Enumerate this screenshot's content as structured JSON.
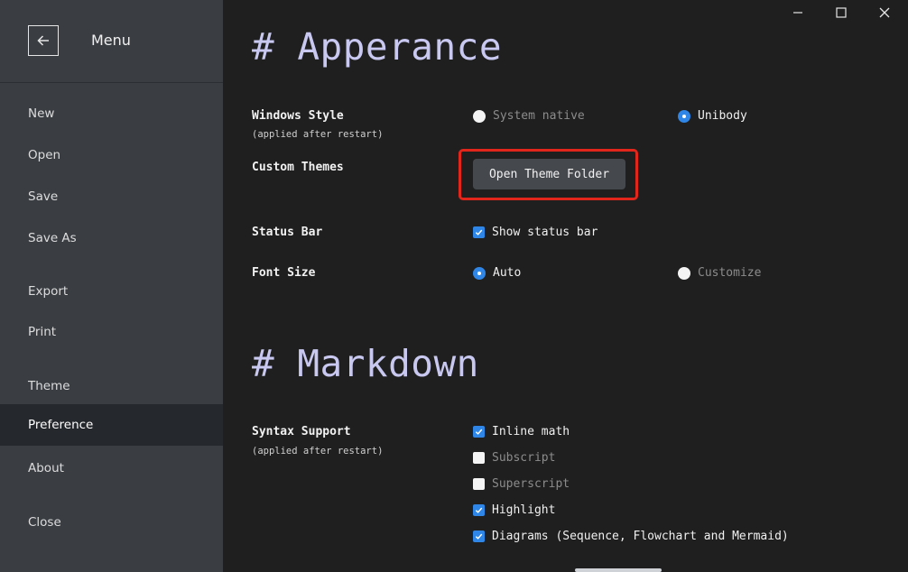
{
  "window": {
    "controls": [
      "minimize-icon",
      "maximize-icon",
      "close-icon"
    ]
  },
  "sidebar": {
    "title": "Menu",
    "back_icon": "arrow-left-icon",
    "items": [
      {
        "label": "New"
      },
      {
        "label": "Open"
      },
      {
        "label": "Save"
      },
      {
        "label": "Save As"
      },
      {
        "label": "Export"
      },
      {
        "label": "Print"
      },
      {
        "label": "Theme"
      },
      {
        "label": "Preference",
        "active": true
      },
      {
        "label": "About"
      },
      {
        "label": "Close"
      }
    ]
  },
  "appearance": {
    "heading": "# Apperance",
    "windows_style": {
      "label": "Windows Style",
      "note": "(applied after restart)",
      "options": [
        {
          "label": "System native",
          "selected": false
        },
        {
          "label": "Unibody",
          "selected": true
        }
      ]
    },
    "custom_themes": {
      "label": "Custom Themes",
      "button": "Open Theme Folder",
      "highlight_color": "#e2261b"
    },
    "status_bar": {
      "label": "Status Bar",
      "option": {
        "label": "Show status bar",
        "checked": true
      }
    },
    "font_size": {
      "label": "Font Size",
      "options": [
        {
          "label": "Auto",
          "selected": true
        },
        {
          "label": "Customize",
          "selected": false
        }
      ]
    }
  },
  "markdown": {
    "heading": "# Markdown",
    "syntax_support": {
      "label": "Syntax Support",
      "note": "(applied after restart)",
      "options": [
        {
          "label": "Inline math",
          "checked": true
        },
        {
          "label": "Subscript",
          "checked": false
        },
        {
          "label": "Superscript",
          "checked": false
        },
        {
          "label": "Highlight",
          "checked": true
        },
        {
          "label": "Diagrams (Sequence, Flowchart and Mermaid)",
          "checked": true
        }
      ]
    }
  },
  "colors": {
    "accent": "#2f86e6",
    "sidebar_bg": "#3a3e43",
    "main_bg": "#1f1f1f",
    "heading": "#c8c8f0"
  }
}
